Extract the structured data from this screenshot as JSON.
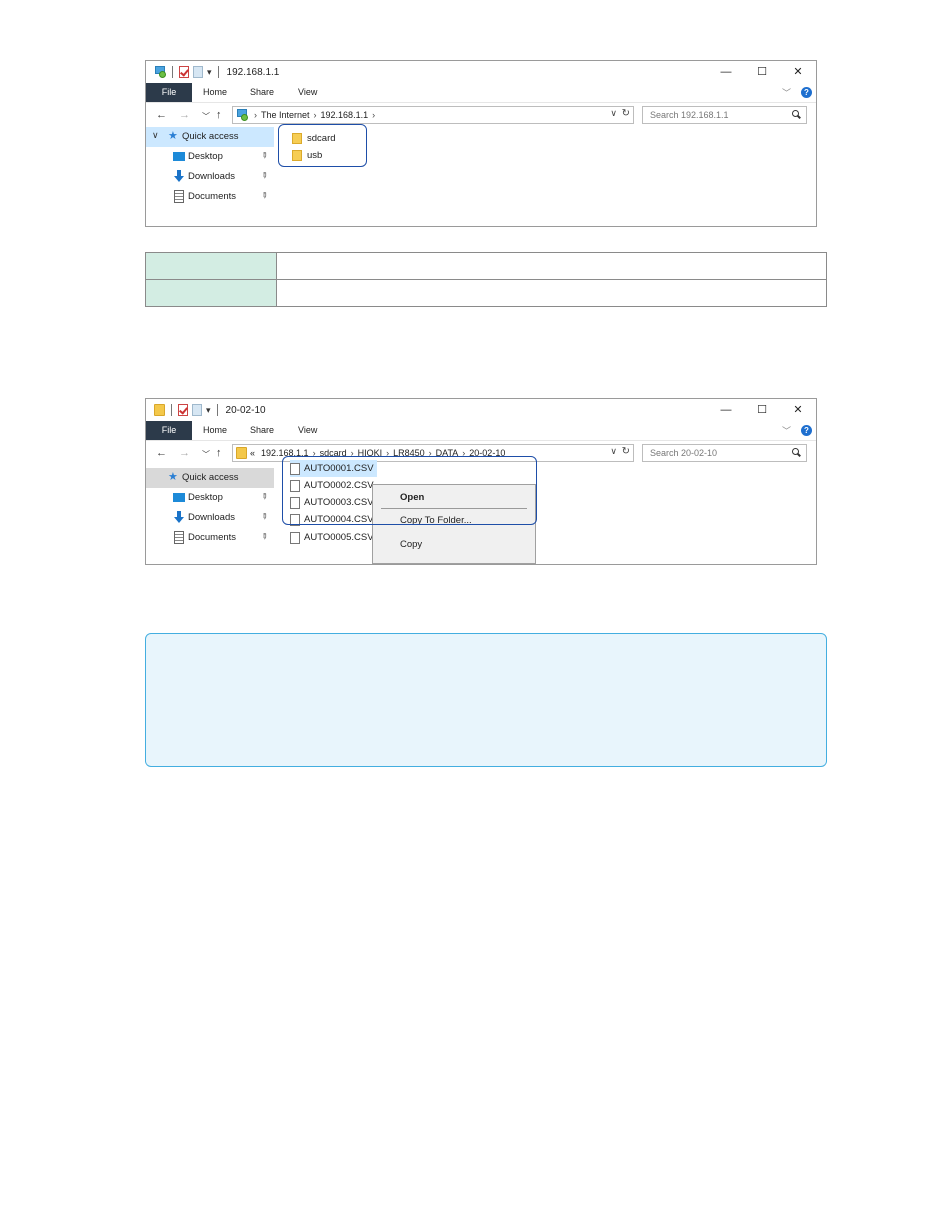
{
  "window1": {
    "title": "192.168.1.1",
    "qat_dropdown_glyph": "▾",
    "controls": {
      "minimize": "—",
      "maximize": "☐",
      "close": "✕"
    },
    "tabs": [
      "File",
      "Home",
      "Share",
      "View"
    ],
    "address": {
      "root": "The Internet",
      "host": "192.168.1.1"
    },
    "search_placeholder": "Search 192.168.1.1",
    "nav": {
      "quick_access": "Quick access",
      "desktop": "Desktop",
      "downloads": "Downloads",
      "documents": "Documents"
    },
    "folders": [
      "sdcard",
      "usb"
    ]
  },
  "info_table": [
    {
      "header": "",
      "value": ""
    },
    {
      "header": "",
      "value": ""
    }
  ],
  "window2": {
    "title": "20-02-10",
    "qat_dropdown_glyph": "▾",
    "controls": {
      "minimize": "—",
      "maximize": "☐",
      "close": "✕"
    },
    "tabs": [
      "File",
      "Home",
      "Share",
      "View"
    ],
    "address": {
      "overflow": "«",
      "crumbs": [
        "192.168.1.1",
        "sdcard",
        "HIOKI",
        "LR8450",
        "DATA",
        "20-02-10"
      ]
    },
    "search_placeholder": "Search 20-02-10",
    "nav": {
      "quick_access": "Quick access",
      "desktop": "Desktop",
      "downloads": "Downloads",
      "documents": "Documents"
    },
    "files": [
      "AUTO0001.CSV",
      "AUTO0002.CSV",
      "AUTO0003.CSV",
      "AUTO0004.CSV",
      "AUTO0005.CSV"
    ],
    "context_menu": {
      "open": "Open",
      "copy_to_folder": "Copy To Folder...",
      "copy": "Copy"
    }
  },
  "note": {
    "text": ""
  },
  "icons": {
    "back": "arrow-left-icon",
    "forward": "arrow-right-icon",
    "recent": "chevron-down-icon",
    "up": "arrow-up-icon",
    "refresh": "refresh-icon",
    "search": "search-icon",
    "help": "help-icon",
    "pin": "pin-icon"
  },
  "colors": {
    "file_tab": "#2c3a4a",
    "selection": "#cce8ff",
    "highlight_border": "#1e4ea8",
    "table_header": "#d3ede3",
    "note_border": "#43aee0",
    "note_bg": "#e8f5fc"
  }
}
